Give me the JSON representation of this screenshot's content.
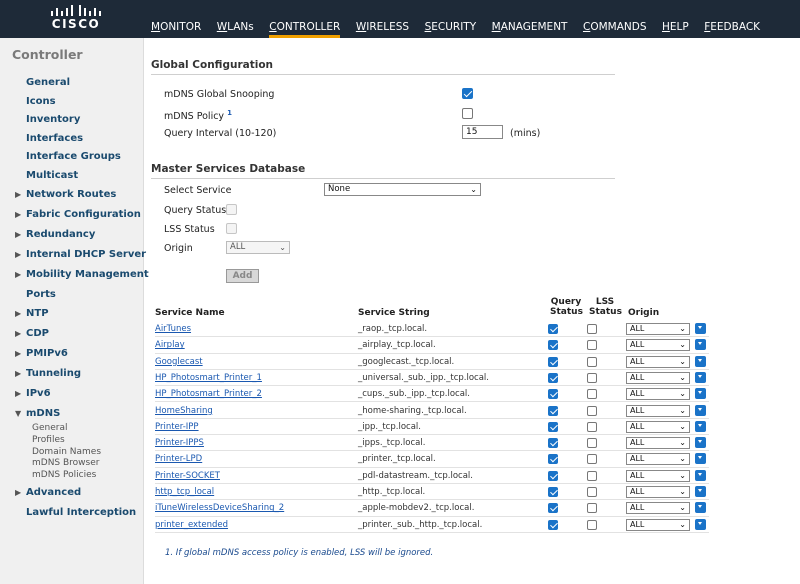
{
  "brand": {
    "logo_text": "CISCO"
  },
  "nav": [
    "MONITOR",
    "WLANs",
    "CONTROLLER",
    "WIRELESS",
    "SECURITY",
    "MANAGEMENT",
    "COMMANDS",
    "HELP",
    "FEEDBACK"
  ],
  "nav_active": "CONTROLLER",
  "sidebar": {
    "title": "Controller",
    "items": [
      "General",
      "Icons",
      "Inventory",
      "Interfaces",
      "Interface Groups",
      "Multicast",
      "Network Routes",
      "Fabric Configuration",
      "Redundancy",
      "Internal DHCP Server",
      "Mobility Management",
      "Ports",
      "NTP",
      "CDP",
      "PMIPv6",
      "Tunneling",
      "IPv6",
      "mDNS",
      "Advanced",
      "Lawful Interception"
    ],
    "mdns_sub": [
      "General",
      "Profiles",
      "Domain Names",
      "mDNS Browser",
      "mDNS Policies"
    ]
  },
  "global": {
    "title": "Global Configuration",
    "snooping_label": "mDNS Global Snooping",
    "snooping_checked": true,
    "policy_label": "mDNS Policy",
    "policy_sup": "1",
    "policy_checked": false,
    "interval_label": "Query Interval (10-120)",
    "interval_value": "15",
    "interval_unit": "(mins)"
  },
  "msd": {
    "title": "Master Services Database",
    "select_service_label": "Select Service",
    "select_service_value": "None",
    "query_status_label": "Query Status",
    "lss_status_label": "LSS Status",
    "origin_label": "Origin",
    "origin_value": "ALL",
    "add_label": "Add"
  },
  "table": {
    "headers": {
      "name": "Service Name",
      "string": "Service String",
      "query": "Query Status",
      "lss": "LSS Status",
      "origin": "Origin"
    },
    "rows": [
      {
        "name": "AirTunes",
        "string": "_raop._tcp.local.",
        "query": true,
        "lss": false,
        "origin": "ALL"
      },
      {
        "name": "Airplay",
        "string": "_airplay._tcp.local.",
        "query": true,
        "lss": false,
        "origin": "ALL"
      },
      {
        "name": "Googlecast",
        "string": "_googlecast._tcp.local.",
        "query": true,
        "lss": false,
        "origin": "ALL"
      },
      {
        "name": "HP_Photosmart_Printer_1",
        "string": "_universal._sub._ipp._tcp.local.",
        "query": true,
        "lss": false,
        "origin": "ALL"
      },
      {
        "name": "HP_Photosmart_Printer_2",
        "string": "_cups._sub._ipp._tcp.local.",
        "query": true,
        "lss": false,
        "origin": "ALL"
      },
      {
        "name": "HomeSharing",
        "string": "_home-sharing._tcp.local.",
        "query": true,
        "lss": false,
        "origin": "ALL"
      },
      {
        "name": "Printer-IPP",
        "string": "_ipp._tcp.local.",
        "query": true,
        "lss": false,
        "origin": "ALL"
      },
      {
        "name": "Printer-IPPS",
        "string": "_ipps._tcp.local.",
        "query": true,
        "lss": false,
        "origin": "ALL"
      },
      {
        "name": "Printer-LPD",
        "string": "_printer._tcp.local.",
        "query": true,
        "lss": false,
        "origin": "ALL"
      },
      {
        "name": "Printer-SOCKET",
        "string": "_pdl-datastream._tcp.local.",
        "query": true,
        "lss": false,
        "origin": "ALL"
      },
      {
        "name": "http_tcp_local",
        "string": "_http._tcp.local.",
        "query": true,
        "lss": false,
        "origin": "ALL"
      },
      {
        "name": "iTuneWirelessDeviceSharing_2",
        "string": "_apple-mobdev2._tcp.local.",
        "query": true,
        "lss": false,
        "origin": "ALL"
      },
      {
        "name": "printer_extended",
        "string": "_printer._sub._http._tcp.local.",
        "query": true,
        "lss": false,
        "origin": "ALL"
      }
    ]
  },
  "footnote": "1. If global mDNS access policy is enabled, LSS will be ignored.",
  "colors": {
    "topbar": "#1e2a38",
    "accent": "#f0a000",
    "checkbox": "#1a73c8",
    "link": "#1a58b0"
  }
}
